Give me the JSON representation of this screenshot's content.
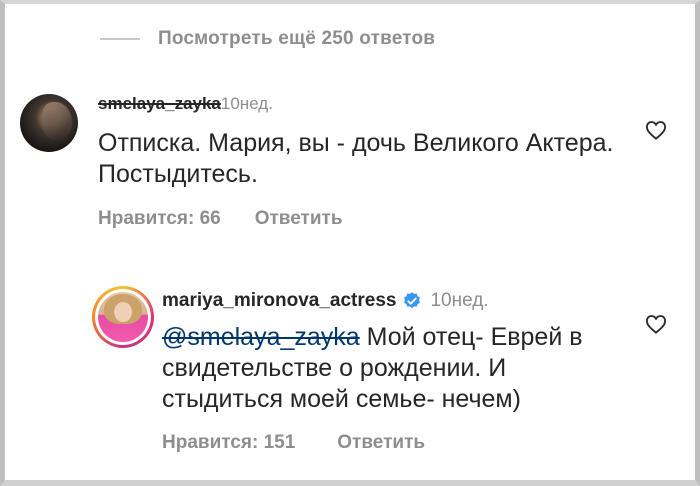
{
  "thread": {
    "view_more": "Посмотреть ещё 250 ответов"
  },
  "comments": [
    {
      "username": "smelaya_zayka",
      "time": "10нед.",
      "text": "Отписка. Мария, вы - дочь Великого Актера. Постыдитесь.",
      "likes_label": "Нравится: 66",
      "reply_label": "Ответить",
      "like_icon": "heart-outline-icon"
    },
    {
      "username": "mariya_mironova_actress",
      "verified": true,
      "verified_color": "#3897f0",
      "time": "10нед.",
      "mention": "@smelaya_zayka",
      "text": " Мой отец- Еврей в свидетельстве о рождении. И стыдиться моей семье- нечем)",
      "likes_label": "Нравится: 151",
      "reply_label": "Ответить",
      "like_icon": "heart-outline-icon"
    }
  ],
  "colors": {
    "primary_text": "#262626",
    "secondary_text": "#8e8e8e",
    "mention": "#00376b"
  }
}
